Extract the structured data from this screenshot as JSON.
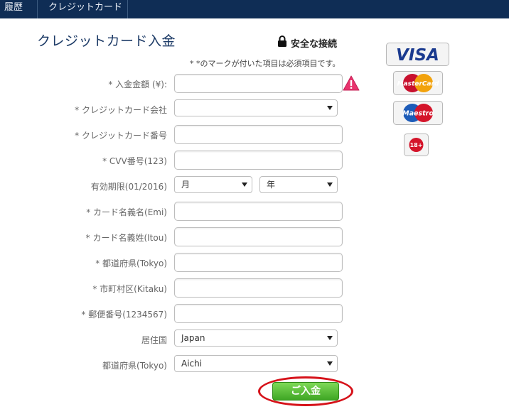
{
  "nav": {
    "tabs": [
      {
        "label": "履歴"
      },
      {
        "label": "クレジットカード"
      }
    ]
  },
  "page": {
    "title": "クレジットカード入金",
    "secure_label": "安全な接続",
    "required_note": "* *のマークが付いた項目は必須項目です。"
  },
  "form": {
    "amount_label": "* 入金金額 (¥):",
    "amount_value": "",
    "company_label": "* クレジットカード会社",
    "company_value": "",
    "card_number_label": "* クレジットカード番号",
    "card_number_value": "",
    "cvv_label": "* CVV番号(123)",
    "cvv_value": "",
    "expiry_label": "有効期限(01/2016)",
    "expiry_month": "月",
    "expiry_year": "年",
    "first_name_label": "* カード名義名(Emi)",
    "first_name_value": "",
    "last_name_label": "* カード名義姓(Itou)",
    "last_name_value": "",
    "prefecture_label": "* 都道府県(Tokyo)",
    "prefecture_value": "",
    "city_label": "* 市町村区(Kitaku)",
    "city_value": "",
    "postal_label": "* 郵便番号(1234567)",
    "postal_value": "",
    "country_label": "居住国",
    "country_value": "Japan",
    "region_label": "都道府県(Tokyo)",
    "region_value": "Aichi",
    "submit_label": "ご入金"
  },
  "logos": {
    "visa": "VISA",
    "mastercard": "MasterCard",
    "maestro": "Maestro",
    "age": "18+"
  },
  "colors": {
    "nav_bg": "#0f2d55",
    "title": "#1c3a66",
    "submit": "#3fa624",
    "highlight": "#d6121a",
    "warning": "#e8336d"
  }
}
